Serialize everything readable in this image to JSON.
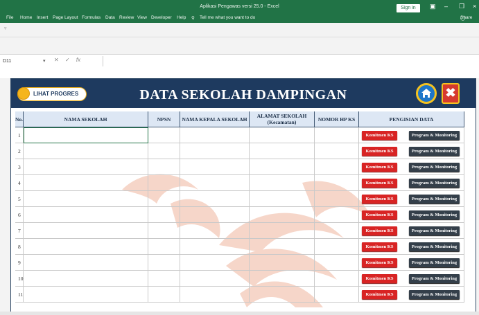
{
  "app": {
    "title": "Aplikasi Pengawas versi 25.0 - Excel",
    "sign_in": "Sign in",
    "share": "Share"
  },
  "menu": [
    "File",
    "Home",
    "Insert",
    "Page Layout",
    "Formulas",
    "Data",
    "Review",
    "View",
    "Developer",
    "Help",
    "Tell me what you want to do"
  ],
  "formula_bar": {
    "name_box": "D11",
    "fx_label": "fx",
    "value": ""
  },
  "banner": {
    "progress_button": "LIHAT PROGRES",
    "title": "DATA SEKOLAH DAMPINGAN",
    "home_icon": "home-icon",
    "exit_icon": "exit-icon"
  },
  "table": {
    "headers": [
      "No.",
      "NAMA SEKOLAH",
      "NPSN",
      "NAMA KEPALA SEKOLAH",
      "ALAMAT SEKOLAH (Kecamatan)",
      "NOMOR HP KS",
      "PENGISIAN DATA"
    ],
    "rows": [
      "1",
      "2",
      "3",
      "4",
      "5",
      "6",
      "7",
      "8",
      "9",
      "10",
      "11"
    ],
    "button_komitmen": "Komitmen KS",
    "button_program": "Program & Monitoring"
  },
  "colors": {
    "excel_green": "#217346",
    "banner_navy": "#1e3a5f",
    "button_red": "#d82424",
    "button_dark": "#343f4a"
  }
}
